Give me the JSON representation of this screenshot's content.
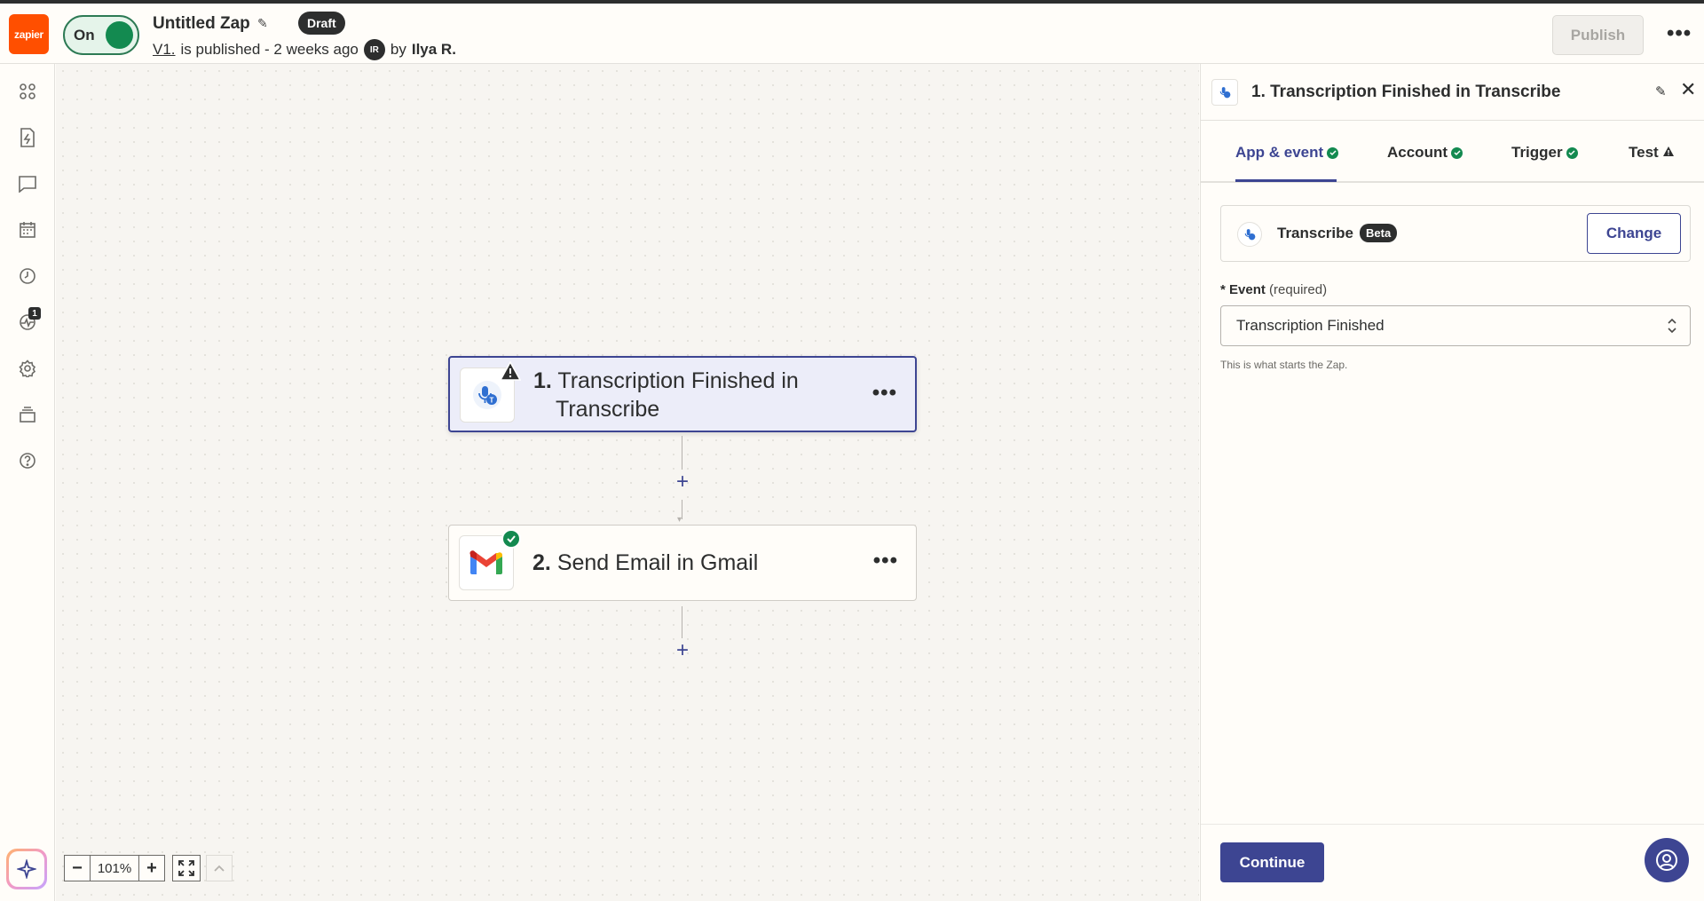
{
  "header": {
    "logo_text": "zapier",
    "toggle_label": "On",
    "zap_title": "Untitled Zap",
    "status_badge": "Draft",
    "version_link": "V1.",
    "version_text": "is published - 2 weeks ago",
    "author_initials": "IR",
    "by_text": "by",
    "author_name": "Ilya R.",
    "publish_label": "Publish"
  },
  "rail": {
    "notification_count": "1",
    "icons": [
      "apps-icon",
      "zap-file-icon",
      "chat-icon",
      "calendar-icon",
      "history-icon",
      "activity-icon",
      "settings-icon",
      "layers-icon",
      "help-icon"
    ]
  },
  "canvas": {
    "steps": [
      {
        "number": "1.",
        "title_line1": "Transcription Finished in",
        "title_line2": "Transcribe",
        "status": "warning"
      },
      {
        "number": "2.",
        "title": "Send Email in Gmail",
        "status": "ok"
      }
    ],
    "zoom_value": "101%"
  },
  "panel": {
    "title": "1. Transcription Finished in Transcribe",
    "tabs": [
      {
        "label": "App & event",
        "status": "ok"
      },
      {
        "label": "Account",
        "status": "ok"
      },
      {
        "label": "Trigger",
        "status": "ok"
      },
      {
        "label": "Test",
        "status": "warning"
      }
    ],
    "app_name": "Transcribe",
    "app_badge": "Beta",
    "change_label": "Change",
    "event_label_star": "*",
    "event_label": "Event",
    "event_required": "(required)",
    "event_value": "Transcription Finished",
    "event_help": "This is what starts the Zap.",
    "continue_label": "Continue"
  },
  "colors": {
    "accent": "#3d4592",
    "brand": "#ff4f00",
    "success": "#138a50"
  }
}
